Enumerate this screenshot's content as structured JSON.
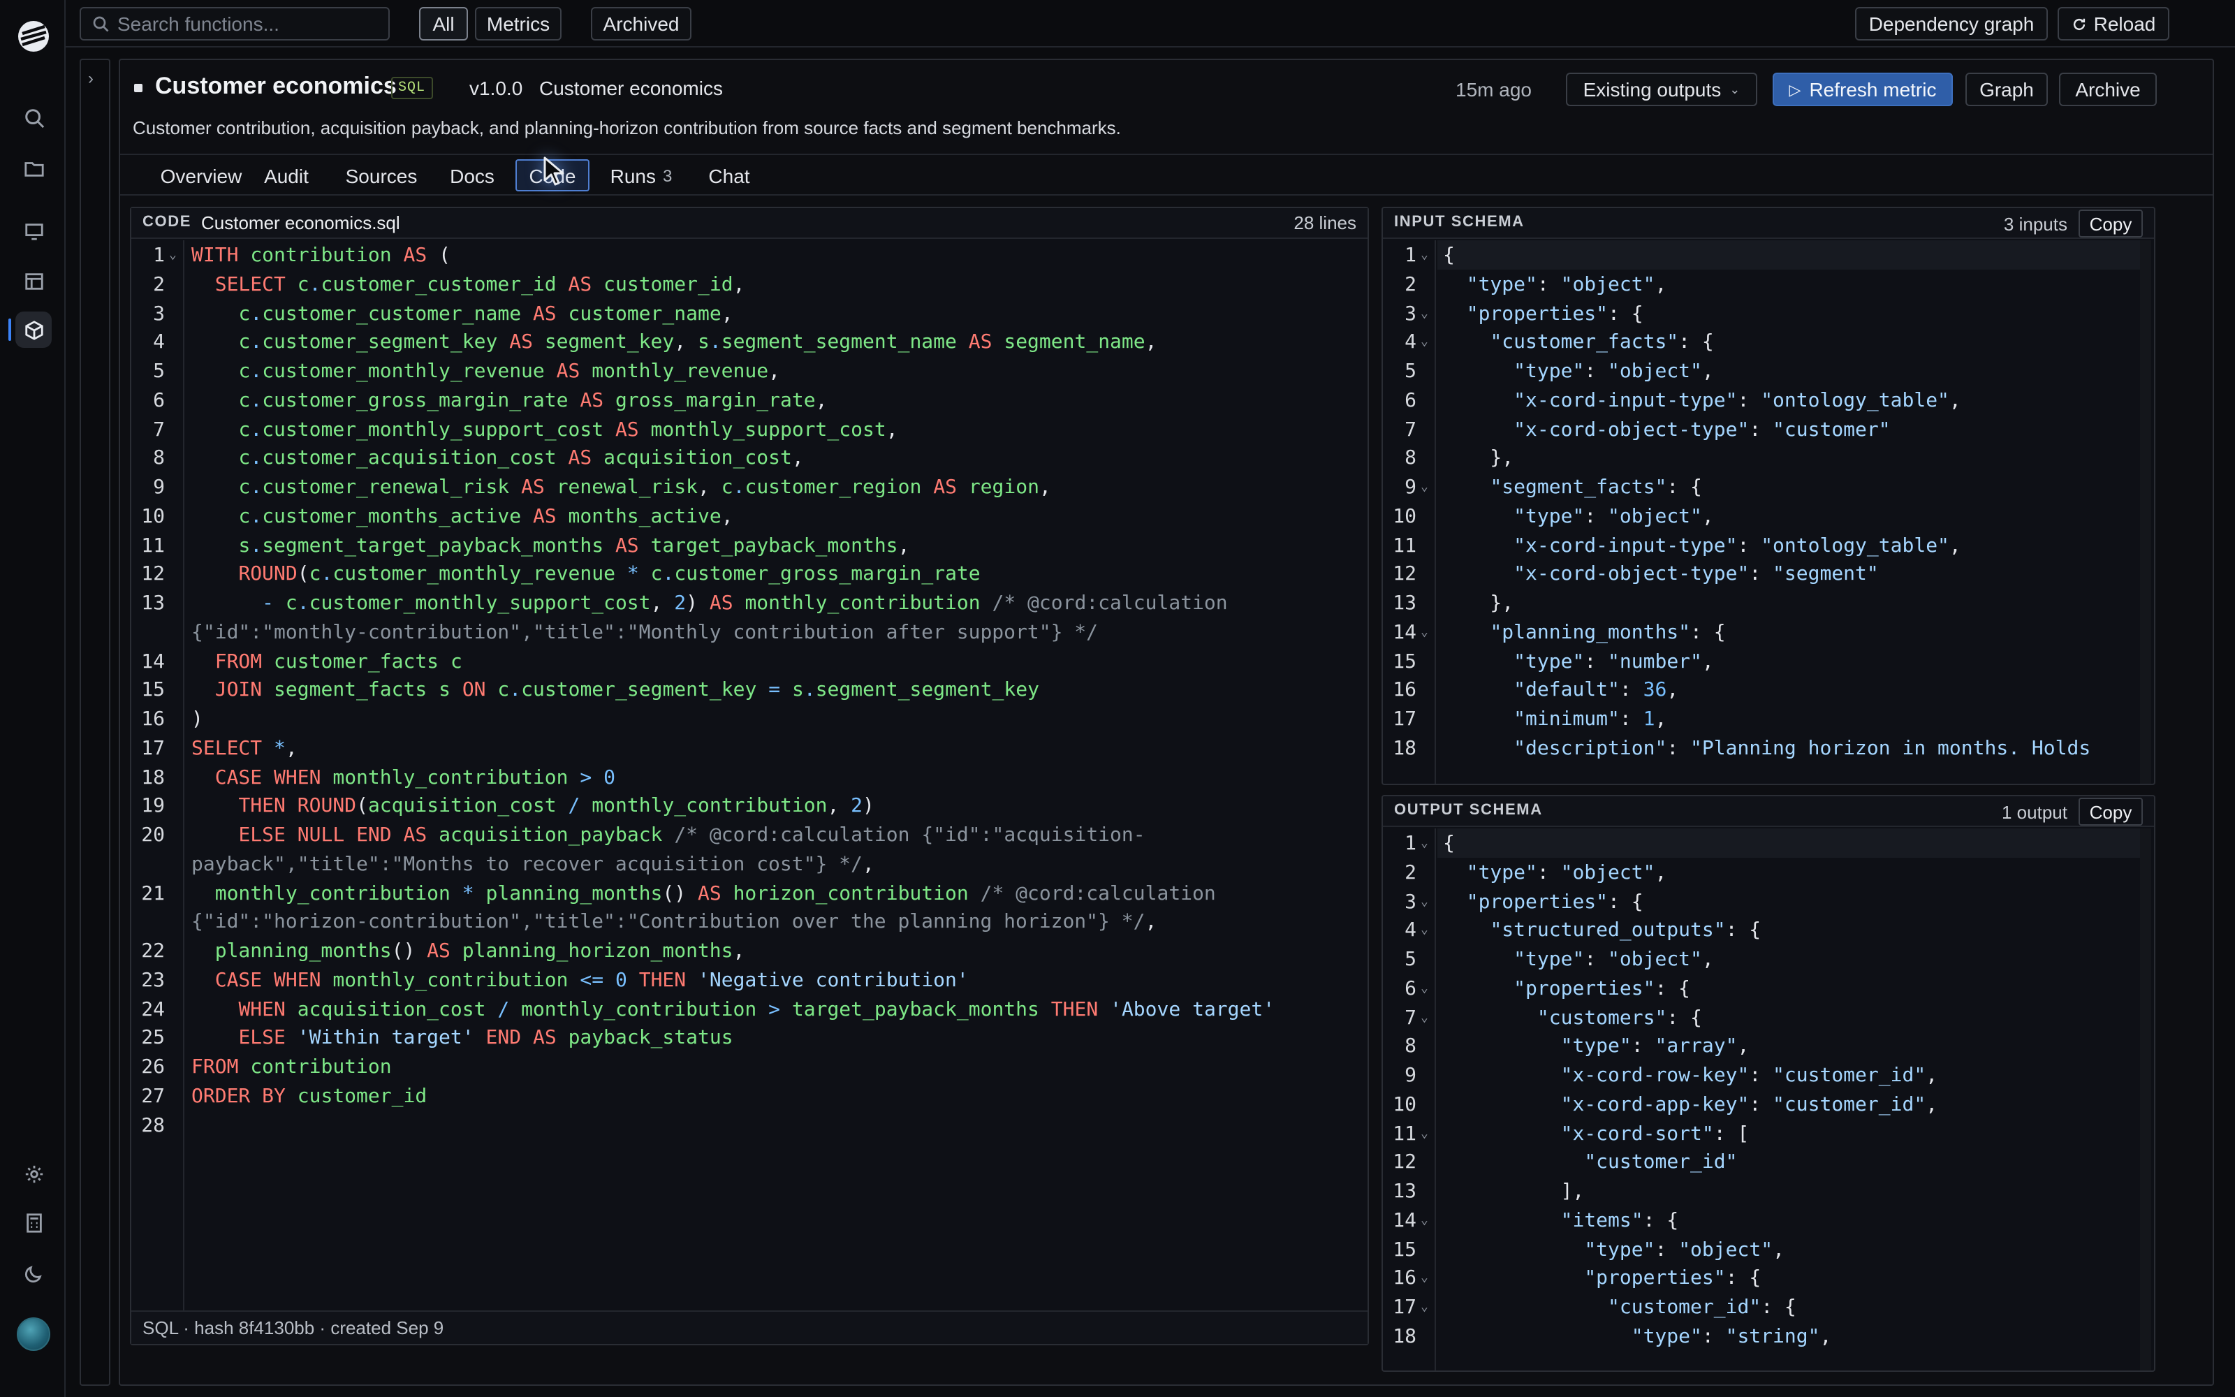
{
  "topbar": {
    "search_placeholder": "Search functions...",
    "filters": [
      "All",
      "Metrics",
      "Archived"
    ],
    "dependency_graph": "Dependency graph",
    "reload": "Reload"
  },
  "header": {
    "title": "Customer economics",
    "badge": "SQL",
    "version": "v1.0.0",
    "version_name": "Customer economics",
    "updated": "15m ago",
    "existing_outputs": "Existing outputs",
    "refresh": "Refresh metric",
    "graph": "Graph",
    "archive": "Archive",
    "description": "Customer contribution, acquisition payback, and planning-horizon contribution from source facts and segment benchmarks."
  },
  "tabs": [
    {
      "label": "Overview"
    },
    {
      "label": "Audit"
    },
    {
      "label": "Sources"
    },
    {
      "label": "Docs"
    },
    {
      "label": "Code"
    },
    {
      "label": "Runs",
      "count": "3"
    },
    {
      "label": "Chat"
    }
  ],
  "code": {
    "label": "CODE",
    "filename": "Customer economics.sql",
    "line_count": "28 lines",
    "footer": "SQL · hash 8f4130bb · created Sep 9"
  },
  "input_schema": {
    "label": "INPUT SCHEMA",
    "count": "3 inputs",
    "copy": "Copy"
  },
  "output_schema": {
    "label": "OUTPUT SCHEMA",
    "count": "1 output",
    "copy": "Copy"
  },
  "icons": {
    "sidebar": [
      "logo-icon",
      "search-icon",
      "folder-icon",
      "monitor-icon",
      "layout-icon",
      "cube-icon",
      "settings-icon",
      "calculator-icon",
      "moon-icon",
      "avatar"
    ],
    "primary": "#2f5ea8"
  }
}
